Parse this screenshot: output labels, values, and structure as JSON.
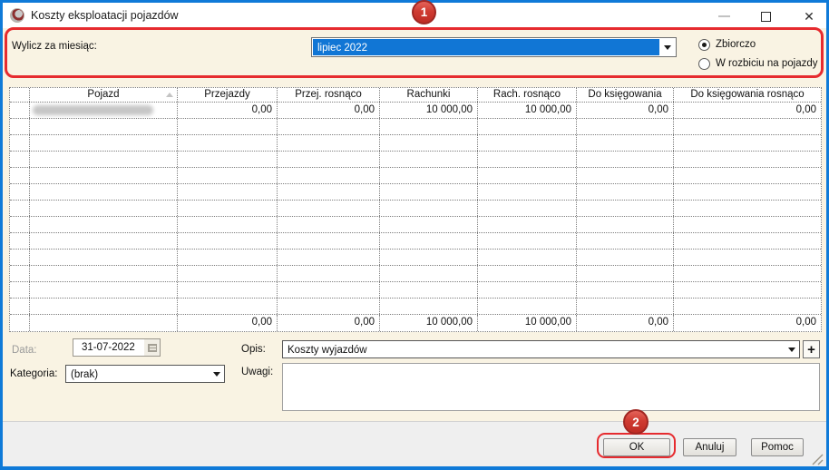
{
  "window": {
    "title": "Koszty eksploatacji pojazdów"
  },
  "filter": {
    "label": "Wylicz za miesiąc:",
    "selected_month": "lipiec 2022",
    "month_combo_focused": true,
    "mode_options": [
      {
        "label": "Zbiorczo",
        "selected": true
      },
      {
        "label": "W rozbiciu na pojazdy",
        "selected": false
      }
    ]
  },
  "grid": {
    "columns": [
      "",
      "Pojazd",
      "Przejazdy",
      "Przej. rosnąco",
      "Rachunki",
      "Rach. rosnąco",
      "Do księgowania",
      "Do księgowania rosnąco"
    ],
    "sort": {
      "column": "Pojazd",
      "direction": "ascending"
    },
    "data_row": {
      "vehicle_redacted": true,
      "values": [
        "0,00",
        "0,00",
        "10 000,00",
        "10 000,00",
        "0,00",
        "0,00"
      ]
    },
    "empty_row_count": 12,
    "totals_row": {
      "values": [
        "0,00",
        "0,00",
        "10 000,00",
        "10 000,00",
        "0,00",
        "0,00"
      ]
    }
  },
  "form": {
    "date": {
      "label": "Data:",
      "value": "31-07-2022",
      "disabled": true
    },
    "category": {
      "label": "Kategoria:",
      "value": "(brak)"
    },
    "description": {
      "label": "Opis:",
      "value": "Koszty wyjazdów",
      "add_button": "+"
    },
    "notes": {
      "label": "Uwagi:",
      "value": ""
    }
  },
  "buttons": {
    "ok": "OK",
    "cancel": "Anuluj",
    "help": "Pomoc"
  },
  "annotations": {
    "step_1": "1",
    "step_2": "2",
    "highlight_color": "#e62b2f"
  }
}
